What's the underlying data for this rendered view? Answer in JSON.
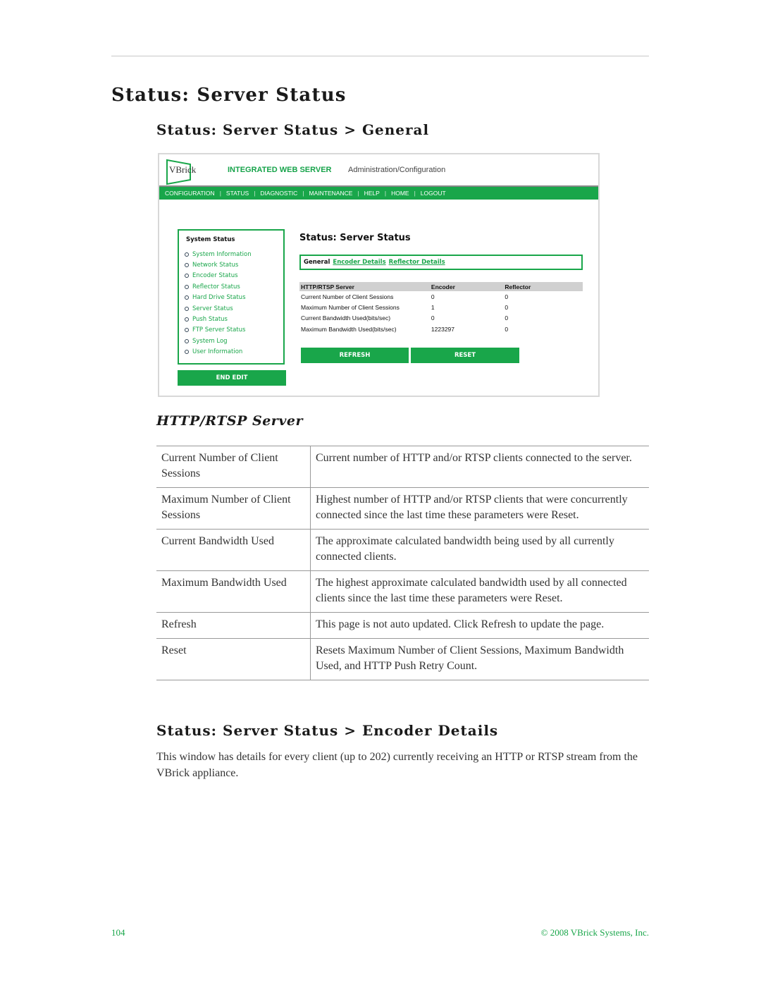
{
  "page": {
    "title": "Status: Server Status",
    "section_general": "Status: Server Status > General",
    "section_encoder": "Status: Server Status > Encoder Details",
    "encoder_paragraph": "This window has details for every client (up to 202) currently receiving an HTTP or RTSP stream from the VBrick appliance.",
    "subheading": "HTTP/RTSP Server"
  },
  "screenshot": {
    "logo_text": "VBrick",
    "app_title": "INTEGRATED WEB SERVER",
    "app_subtitle": "Administration/Configuration",
    "nav": [
      "CONFIGURATION",
      "STATUS",
      "DIAGNOSTIC",
      "MAINTENANCE",
      "HELP",
      "HOME",
      "LOGOUT"
    ],
    "sidebar": {
      "title": "System Status",
      "items": [
        "System Information",
        "Network Status",
        "Encoder Status",
        "Reflector Status",
        "Hard Drive Status",
        "Server Status",
        "Push Status",
        "FTP Server Status",
        "System Log",
        "User Information"
      ]
    },
    "end_edit_label": "END EDIT",
    "panel_title": "Status: Server Status",
    "tabs": {
      "active": "General",
      "links": [
        "Encoder Details",
        "Reflector Details"
      ]
    },
    "table": {
      "headers": [
        "HTTP/RTSP Server",
        "Encoder",
        "Reflector"
      ],
      "rows": [
        [
          "Current Number of Client Sessions",
          "0",
          "0"
        ],
        [
          "Maximum Number of Client Sessions",
          "1",
          "0"
        ],
        [
          "Current Bandwidth Used(bits/sec)",
          "0",
          "0"
        ],
        [
          "Maximum Bandwidth Used(bits/sec)",
          "1223297",
          "0"
        ]
      ]
    },
    "refresh_label": "REFRESH",
    "reset_label": "RESET",
    "colors": {
      "accent": "#19a64a",
      "header_gray": "#d0d0d0"
    }
  },
  "descriptions": [
    {
      "term": "Current Number of Client Sessions",
      "desc": "Current number of HTTP and/or RTSP clients connected to the server."
    },
    {
      "term": "Maximum Number of Client Sessions",
      "desc": "Highest number of HTTP and/or RTSP clients that were concurrently connected since the last time these parameters were Reset."
    },
    {
      "term": "Current Bandwidth Used",
      "desc": "The approximate calculated bandwidth being used by all currently connected clients."
    },
    {
      "term": "Maximum Bandwidth Used",
      "desc": "The highest approximate calculated bandwidth used by all connected clients since the last time these parameters were Reset."
    },
    {
      "term": "Refresh",
      "desc": "This page is not auto updated. Click Refresh to update the page."
    },
    {
      "term": "Reset",
      "desc": "Resets Maximum Number of Client Sessions, Maximum Bandwidth Used, and HTTP Push Retry Count."
    }
  ],
  "footer": {
    "page_number": "104",
    "copyright": "© 2008 VBrick Systems, Inc."
  }
}
